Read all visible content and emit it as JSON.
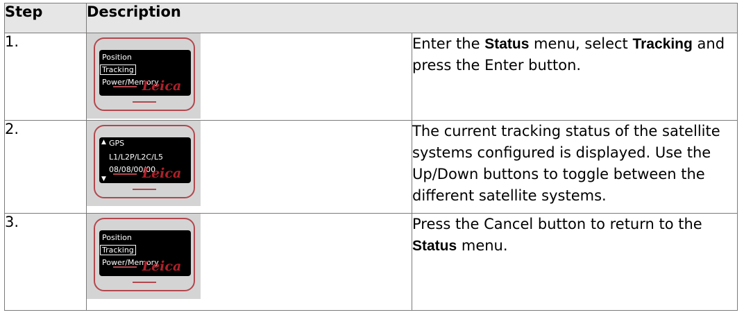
{
  "header": {
    "step": "Step",
    "description": "Description"
  },
  "steps": [
    {
      "number": "1.",
      "display": {
        "lines": [
          "Position",
          "Tracking",
          "Power/Memory"
        ],
        "selected_index": 1,
        "logo": "Leica"
      },
      "text": {
        "p1": "Enter the ",
        "b1": "Status",
        "p2": " menu, select ",
        "b2": "Tracking",
        "p3": " and press the Enter button."
      }
    },
    {
      "number": "2.",
      "display": {
        "lines": [
          "GPS",
          "L1/L2P/L2C/L5",
          "08/08/00/00"
        ],
        "logo": "Leica",
        "scroll_up": "▲",
        "scroll_down": "▼"
      },
      "text": {
        "p1": "The current tracking status of the satellite systems configured is displayed. Use the Up/Down buttons to toggle between the different satellite systems."
      }
    },
    {
      "number": "3.",
      "display": {
        "lines": [
          "Position",
          "Tracking",
          "Power/Memory"
        ],
        "selected_index": 1,
        "logo": "Leica"
      },
      "text": {
        "p1": "Press the Cancel button to return to the ",
        "b1": "Status",
        "p2": " menu."
      }
    }
  ]
}
